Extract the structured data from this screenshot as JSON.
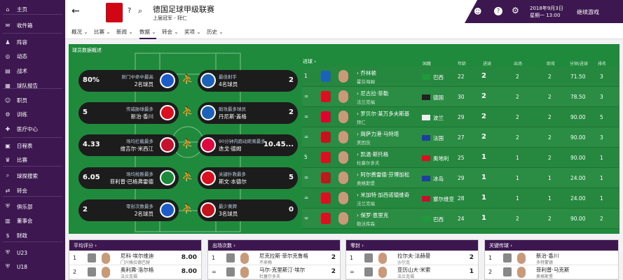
{
  "sidebar": {
    "items": [
      {
        "icon": "home-icon",
        "glyph": "⌂",
        "label": "主页"
      },
      {
        "icon": "inbox-icon",
        "glyph": "✉",
        "label": "收件箱"
      },
      {
        "icon": "squad-icon",
        "glyph": "♟",
        "label": "阵容"
      },
      {
        "icon": "dynamics-icon",
        "glyph": "◎",
        "label": "动态"
      },
      {
        "icon": "tactics-icon",
        "glyph": "▤",
        "label": "战术"
      },
      {
        "icon": "team-report-icon",
        "glyph": "▦",
        "label": "球队报告"
      },
      {
        "icon": "staff-icon",
        "glyph": "☺",
        "label": "职员"
      },
      {
        "icon": "training-icon",
        "glyph": "⚙",
        "label": "训练"
      },
      {
        "icon": "medical-icon",
        "glyph": "✚",
        "label": "医疗中心"
      },
      {
        "icon": "schedule-icon",
        "glyph": "▣",
        "label": "日程表"
      },
      {
        "icon": "competitions-icon",
        "glyph": "♛",
        "label": "比赛"
      },
      {
        "icon": "scouting-icon",
        "glyph": "⌕",
        "label": "球探搜索"
      },
      {
        "icon": "transfers-icon",
        "glyph": "⇄",
        "label": "转会"
      },
      {
        "icon": "club-icon",
        "glyph": "⛨",
        "label": "俱乐部"
      },
      {
        "icon": "board-icon",
        "glyph": "▥",
        "label": "董事会"
      },
      {
        "icon": "finances-icon",
        "glyph": "$",
        "label": "财政"
      },
      {
        "icon": "u23-icon",
        "glyph": "⛨",
        "label": "U23"
      },
      {
        "icon": "u18-icon",
        "glyph": "⛨",
        "label": "U18"
      }
    ]
  },
  "header": {
    "title": "德国足球甲级联赛",
    "subtitle": "上届冠军 - 拜仁",
    "date_line1": "2018年9月3日",
    "date_line2": "星期一 13:00",
    "continue_label": "继续游戏"
  },
  "tabs": [
    "概况",
    "比赛",
    "新闻",
    "数据",
    "转会",
    "奖项",
    "历史"
  ],
  "section_title": "球员数据概述",
  "pills": [
    {
      "lval": "80%",
      "ltitle": "射门中命中最高",
      "lname": "2名球员",
      "rtitle": "最佳射手",
      "rname": "4名球员",
      "rval": "2",
      "lcolor": "#1d5cc8",
      "rcolor": "#1c63b7",
      "icon": "⚽"
    },
    {
      "lval": "5",
      "ltitle": "传威胁球最多",
      "lname": "新治·香川",
      "rtitle": "助攻最多球员",
      "rname": "丹尼斯·盖格",
      "rval": "2",
      "lcolor": "#d8101f",
      "rcolor": "#1c63b7",
      "icon": "⚽"
    },
    {
      "lval": "4.33",
      "ltitle": "场均拦截最多",
      "lname": "维吉尔·米西江",
      "rtitle": "90分钟内跑动距离最多",
      "rname": "迭戈·德姆",
      "rval": "10.45...",
      "lcolor": "#c4122f",
      "rcolor": "#dd0741",
      "icon": "⚽"
    },
    {
      "lval": "6.05",
      "ltitle": "场均抢断最多",
      "lname": "菲利普·巴格弗雷德",
      "rtitle": "关键扑救最多",
      "rname": "斯文·本德尔",
      "rval": "5",
      "lcolor": "#1a8a3a",
      "rcolor": "#d8101f",
      "icon": "⚽"
    },
    {
      "lval": "2",
      "ltitle": "零封次数最多",
      "lname": "2名球员",
      "rtitle": "最少黄牌",
      "rname": "3名球员",
      "rval": "0",
      "lcolor": "#1d5cc8",
      "rcolor": "#c3141e",
      "icon": "⚽"
    }
  ],
  "table": {
    "link": "进球 ›",
    "headers": {
      "nation": "国籍",
      "age": "年龄",
      "goals": "进球",
      "apps": "出场",
      "assists": "助攻",
      "mins": "分钟/进球",
      "rating": "排名"
    },
    "rows": [
      {
        "pos": "1",
        "name": "乔林顿",
        "club": "霍芬海姆",
        "clubcolor": "#1c63b7",
        "nation": "巴西",
        "flag": "#1e9a3a",
        "age": "22",
        "goals": "2",
        "apps": "2",
        "assists": "2",
        "mins": "71.50",
        "rank": "3"
      },
      {
        "pos": "=",
        "name": "尼古拉·菲勒",
        "club": "法兰克福",
        "clubcolor": "#d8101f",
        "nation": "德国",
        "flag": "#222",
        "age": "30",
        "goals": "2",
        "apps": "2",
        "assists": "2",
        "mins": "78.50",
        "rank": "3"
      },
      {
        "pos": "=",
        "name": "罗贝尔·莱万多夫斯基",
        "club": "拜仁",
        "clubcolor": "#dc052d",
        "nation": "波兰",
        "flag": "#eee",
        "age": "29",
        "goals": "2",
        "apps": "2",
        "assists": "2",
        "mins": "90.00",
        "rank": "5"
      },
      {
        "pos": "=",
        "name": "简萨力港·马特塔",
        "club": "美因茨",
        "clubcolor": "#c3141e",
        "nation": "法国",
        "flag": "#1d3f9c",
        "age": "27",
        "goals": "2",
        "apps": "2",
        "assists": "2",
        "mins": "90.00",
        "rank": "3"
      },
      {
        "pos": "5",
        "name": "凯温·斯托格",
        "club": "杜塞尔多夫",
        "clubcolor": "#d8101f",
        "nation": "奥地利",
        "flag": "#d8101f",
        "age": "25",
        "goals": "1",
        "apps": "1",
        "assists": "2",
        "mins": "90.00",
        "rank": "1"
      },
      {
        "pos": "=",
        "name": "阿尔费雷德·芬博加松",
        "club": "奥格斯堡",
        "clubcolor": "#b71c1c",
        "nation": "冰岛",
        "flag": "#1d3f9c",
        "age": "29",
        "goals": "1",
        "apps": "1",
        "assists": "1",
        "mins": "24.00",
        "rank": "1"
      },
      {
        "pos": "=",
        "name": "米加特·加西诺德维奇",
        "club": "法兰克福",
        "clubcolor": "#d8101f",
        "nation": "塞尔维亚",
        "flag": "#c8102e",
        "age": "28",
        "goals": "1",
        "apps": "1",
        "assists": "1",
        "mins": "24.00",
        "rank": "1"
      },
      {
        "pos": "=",
        "name": "保罗·恩里克",
        "club": "勒沃库森",
        "clubcolor": "#d8101f",
        "nation": "巴西",
        "flag": "#1e9a3a",
        "age": "24",
        "goals": "1",
        "apps": "2",
        "assists": "2",
        "mins": "90.00",
        "rank": "2"
      }
    ]
  },
  "bottom_panels": [
    {
      "title": "平均评分 ›",
      "rows": [
        {
          "pos": "1",
          "name": "尼科·埃尔维迪",
          "club": "门兴格拉德巴赫",
          "val": "8.00"
        },
        {
          "pos": "2",
          "name": "奥利弗·洛尔格",
          "club": "法兰克福",
          "val": "8.00"
        }
      ]
    },
    {
      "title": "出场次数 ›",
      "rows": [
        {
          "pos": "1",
          "name": "尼克拉斯·菲尔克鲁格",
          "club": "不来梅",
          "val": "2"
        },
        {
          "pos": "=",
          "name": "马尔-克里斯汀·埃尔",
          "club": "杜塞尔多夫",
          "val": "2"
        }
      ]
    },
    {
      "title": "零封 ›",
      "rows": [
        {
          "pos": "1",
          "name": "拉尔夫·法赫曼",
          "club": "沙尔克",
          "val": "2"
        },
        {
          "pos": "=",
          "name": "亚历山大·米索",
          "club": "法兰克福",
          "val": "1"
        }
      ]
    },
    {
      "title": "关键传球 ›",
      "rows": [
        {
          "pos": "1",
          "name": "新治·香川",
          "club": "多特蒙德",
          "val": ""
        },
        {
          "pos": "2",
          "name": "菲利普·马克斯",
          "club": "奥格斯堡",
          "val": ""
        }
      ]
    }
  ],
  "colors": {
    "sidebar": "#3d1850",
    "pitch": "#1f8a3b",
    "pill": "#1c1c1c"
  }
}
